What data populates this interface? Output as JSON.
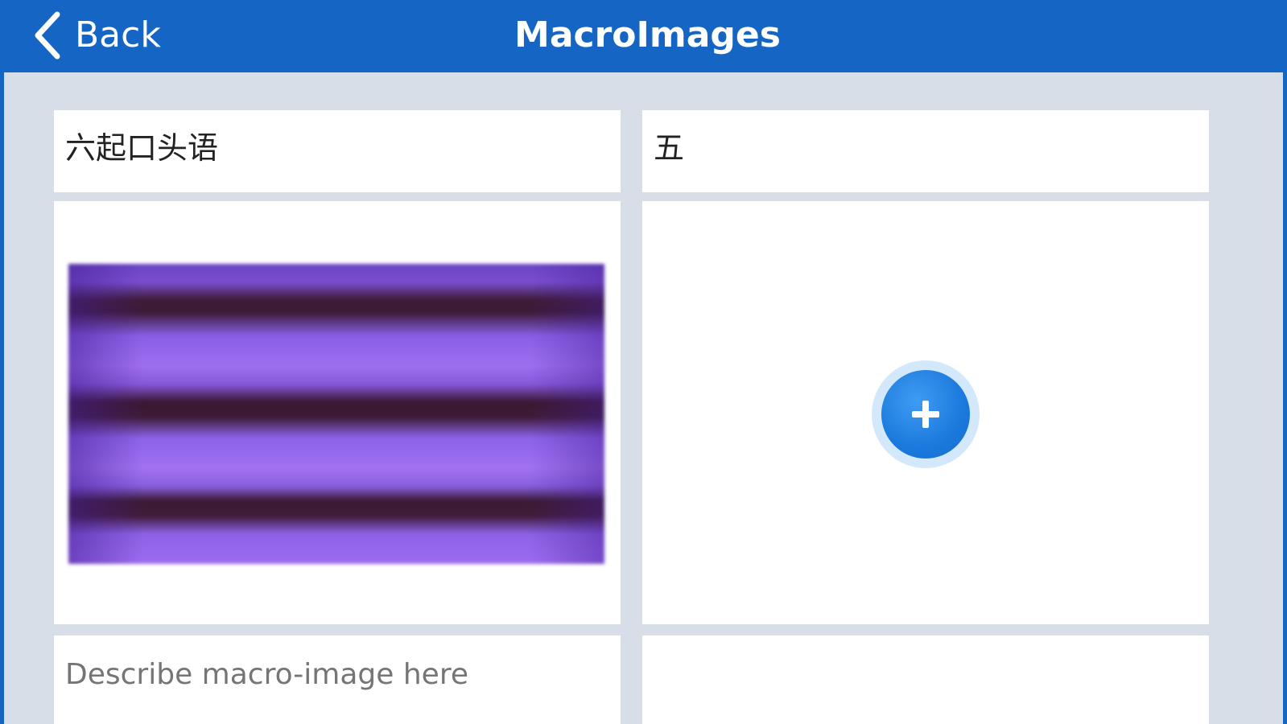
{
  "navbar": {
    "back_label": "Back",
    "title": "MacroImages"
  },
  "macros": [
    {
      "title": "六起口头语",
      "image": "macro-image",
      "description_placeholder": "Describe macro-image here",
      "description_value": ""
    },
    {
      "title": "五",
      "image": "add-image-button",
      "description_placeholder": "",
      "description_value": ""
    }
  ],
  "colors": {
    "navbar": "#1566c4",
    "background": "#d8dee7",
    "accent": "#1b79dd"
  }
}
